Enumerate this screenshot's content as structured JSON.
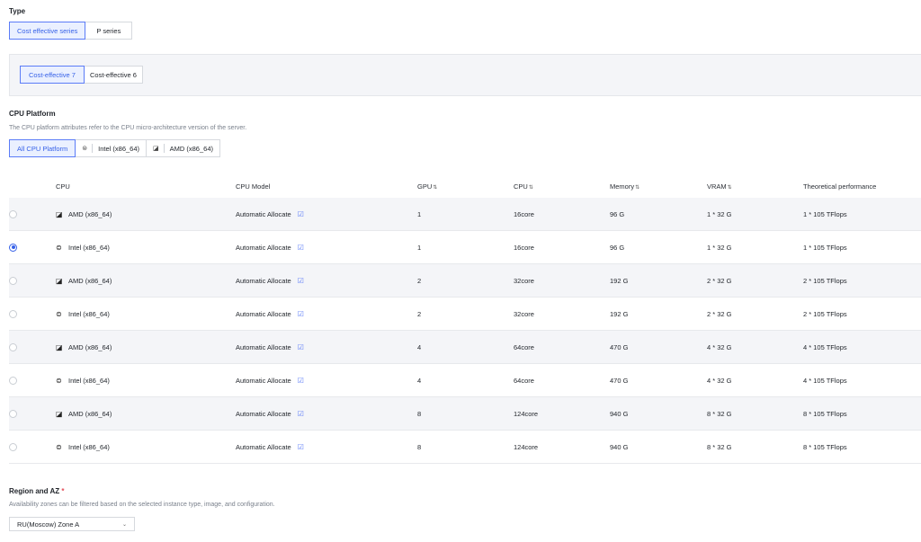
{
  "type_section": {
    "title": "Type",
    "options": [
      "Cost effective series",
      "P series"
    ],
    "selected": "Cost effective series"
  },
  "generation": {
    "options": [
      "Cost-effective 7",
      "Cost-effective 6"
    ],
    "selected": "Cost-effective 7"
  },
  "cpu_platform": {
    "title": "CPU Platform",
    "hint": "The CPU platform attributes refer to the CPU micro-architecture version of the server.",
    "filters": [
      {
        "label": "All CPU Platform",
        "icon": ""
      },
      {
        "label": "Intel (x86_64)",
        "icon": "intel-icon"
      },
      {
        "label": "AMD (x86_64)",
        "icon": "amd-icon"
      }
    ],
    "selected": "All CPU Platform"
  },
  "table": {
    "headers": {
      "cpu": "CPU",
      "cpu_model": "CPU Model",
      "gpu": "GPU",
      "cpu_cores": "CPU",
      "memory": "Memory",
      "vram": "VRAM",
      "perf": "Theoretical performance"
    },
    "sort_glyph": "⇅",
    "rows": [
      {
        "cpu": "AMD (x86_64)",
        "icon": "amd-icon",
        "model": "Automatic Allocate",
        "gpu": "1",
        "cores": "16core",
        "memory": "96 G",
        "vram": "1 * 32 G",
        "perf": "1 * 105 TFlops",
        "selected": false
      },
      {
        "cpu": "Intel (x86_64)",
        "icon": "intel-icon",
        "model": "Automatic Allocate",
        "gpu": "1",
        "cores": "16core",
        "memory": "96 G",
        "vram": "1 * 32 G",
        "perf": "1 * 105 TFlops",
        "selected": true
      },
      {
        "cpu": "AMD (x86_64)",
        "icon": "amd-icon",
        "model": "Automatic Allocate",
        "gpu": "2",
        "cores": "32core",
        "memory": "192 G",
        "vram": "2 * 32 G",
        "perf": "2 * 105 TFlops",
        "selected": false
      },
      {
        "cpu": "Intel (x86_64)",
        "icon": "intel-icon",
        "model": "Automatic Allocate",
        "gpu": "2",
        "cores": "32core",
        "memory": "192 G",
        "vram": "2 * 32 G",
        "perf": "2 * 105 TFlops",
        "selected": false
      },
      {
        "cpu": "AMD (x86_64)",
        "icon": "amd-icon",
        "model": "Automatic Allocate",
        "gpu": "4",
        "cores": "64core",
        "memory": "470 G",
        "vram": "4 * 32 G",
        "perf": "4 * 105 TFlops",
        "selected": false
      },
      {
        "cpu": "Intel (x86_64)",
        "icon": "intel-icon",
        "model": "Automatic Allocate",
        "gpu": "4",
        "cores": "64core",
        "memory": "470 G",
        "vram": "4 * 32 G",
        "perf": "4 * 105 TFlops",
        "selected": false
      },
      {
        "cpu": "AMD (x86_64)",
        "icon": "amd-icon",
        "model": "Automatic Allocate",
        "gpu": "8",
        "cores": "124core",
        "memory": "940 G",
        "vram": "8 * 32 G",
        "perf": "8 * 105 TFlops",
        "selected": false
      },
      {
        "cpu": "Intel (x86_64)",
        "icon": "intel-icon",
        "model": "Automatic Allocate",
        "gpu": "8",
        "cores": "124core",
        "memory": "940 G",
        "vram": "8 * 32 G",
        "perf": "8 * 105 TFlops",
        "selected": false
      }
    ]
  },
  "region": {
    "title": "Region and AZ",
    "required_mark": "*",
    "hint": "Availability zones can be filtered based on the selected instance type, image, and configuration.",
    "selected_zone": "RU(Moscow) Zone A"
  },
  "colors": {
    "accent": "#3661e8",
    "accent_bg": "#eaf0ff",
    "row_shade": "#f4f5f8"
  }
}
